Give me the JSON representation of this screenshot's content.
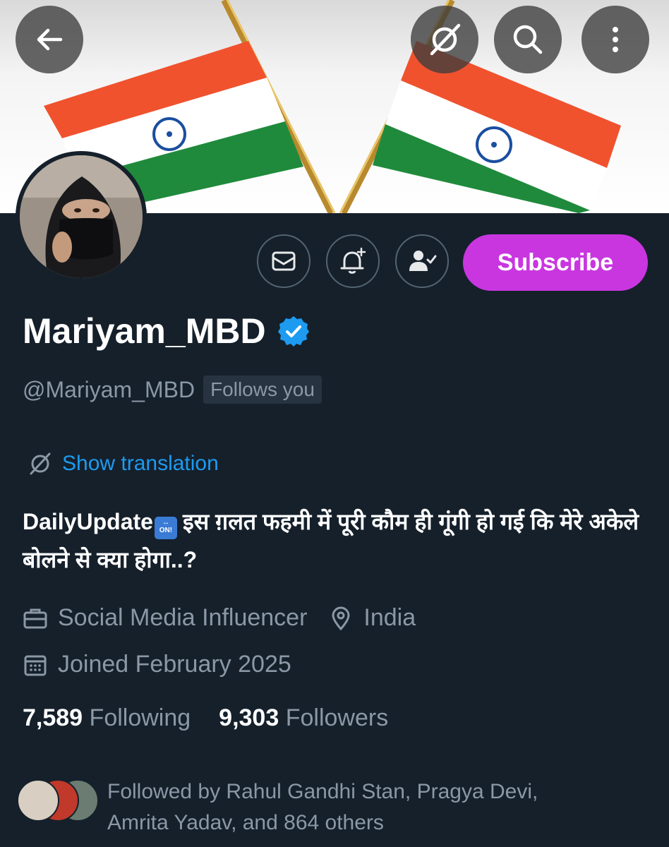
{
  "header": {
    "back_icon": "arrow-left-icon",
    "translate_icon": "translate-off-icon",
    "search_icon": "search-icon",
    "more_icon": "more-vertical-icon"
  },
  "profile": {
    "display_name": "Mariyam_MBD",
    "verified": true,
    "verified_color": "#1d9bf0",
    "handle": "@Mariyam_MBD",
    "follows_you": "Follows you",
    "show_translation": "Show translation",
    "bio_prefix": "DailyUpdate",
    "bio_emoji_text": "ON!",
    "bio_text": "इस ग़लत फहमी में पूरी कौम ही गूंगी हो गई कि मेरे अकेले बोलने से क्या होगा..?",
    "profession": "Social Media Influencer",
    "location": "India",
    "joined": "Joined February 2025",
    "following_count": "7,589",
    "following_label": "Following",
    "followers_count": "9,303",
    "followers_label": "Followers",
    "followed_by_line1": "Followed by Rahul Gandhi Stan, Pragya Devi,",
    "followed_by_line2": "Amrita Yadav, and 864 others"
  },
  "actions": {
    "message_icon": "envelope-icon",
    "notify_icon": "bell-plus-icon",
    "following_icon": "person-check-icon",
    "subscribe_label": "Subscribe",
    "subscribe_color": "#c936e0"
  }
}
